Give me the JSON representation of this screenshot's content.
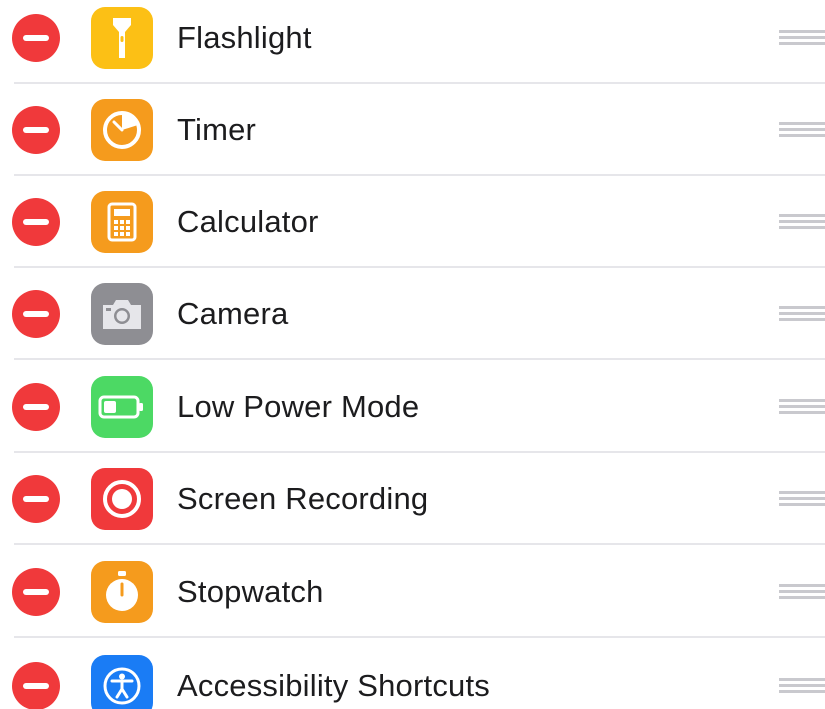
{
  "colors": {
    "remove": "#f0393b",
    "separator": "#e6e6ea",
    "text": "#1c1c1e",
    "handle": "#c9c9ce"
  },
  "controls": [
    {
      "label": "Flashlight",
      "icon": "flashlight-icon",
      "icon_color": "#fcc015"
    },
    {
      "label": "Timer",
      "icon": "timer-icon",
      "icon_color": "#f59b1d"
    },
    {
      "label": "Calculator",
      "icon": "calculator-icon",
      "icon_color": "#f59b1d"
    },
    {
      "label": "Camera",
      "icon": "camera-icon",
      "icon_color": "#8e8e93"
    },
    {
      "label": "Low Power Mode",
      "icon": "battery-icon",
      "icon_color": "#4cd964"
    },
    {
      "label": "Screen Recording",
      "icon": "screen-recording-icon",
      "icon_color": "#f0393b"
    },
    {
      "label": "Stopwatch",
      "icon": "stopwatch-icon",
      "icon_color": "#f59b1d"
    },
    {
      "label": "Accessibility Shortcuts",
      "icon": "accessibility-icon",
      "icon_color": "#1a7cf5"
    }
  ]
}
